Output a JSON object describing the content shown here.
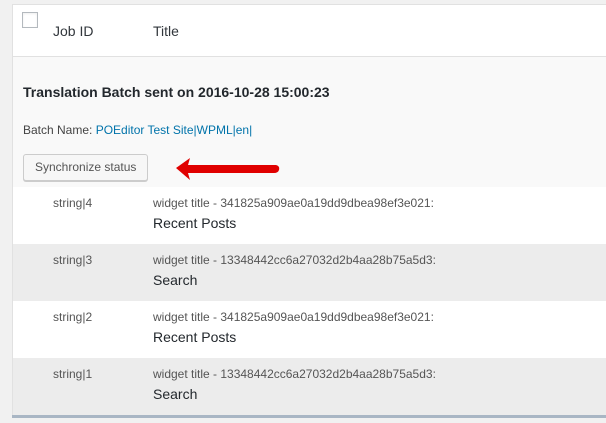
{
  "header": {
    "job_id_label": "Job ID",
    "title_label": "Title"
  },
  "batch": {
    "heading": "Translation Batch sent on 2016-10-28 15:00:23",
    "name_label": "Batch Name: ",
    "name_link": "POEditor Test Site|WPML|en|",
    "sync_button": "Synchronize status"
  },
  "rows": [
    {
      "job_id": "string|4",
      "line1": "widget title - 341825a909ae0a19dd9dbea98ef3e021:",
      "line2": "Recent Posts"
    },
    {
      "job_id": "string|3",
      "line1": "widget title - 13348442cc6a27032d2b4aa28b75a5d3:",
      "line2": "Search"
    },
    {
      "job_id": "string|2",
      "line1": "widget title - 341825a909ae0a19dd9dbea98ef3e021:",
      "line2": "Recent Posts"
    },
    {
      "job_id": "string|1",
      "line1": "widget title - 13348442cc6a27032d2b4aa28b75a5d3:",
      "line2": "Search"
    }
  ],
  "colors": {
    "link": "#0073aa",
    "arrow": "#e00000",
    "row_alt": "#ececec"
  }
}
